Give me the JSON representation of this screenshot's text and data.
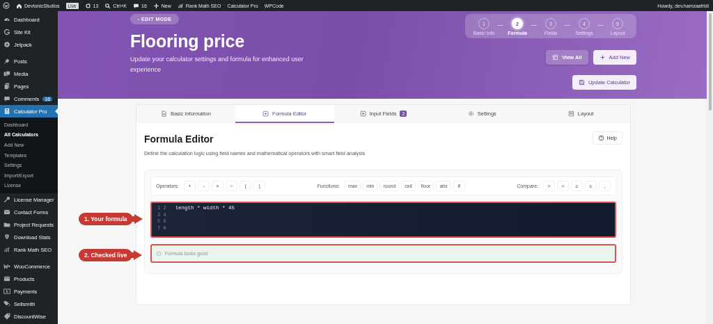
{
  "admin_bar": {
    "items": [
      {
        "kind": "link",
        "label": "DevtonicStudios"
      },
      {
        "kind": "badge",
        "label": "Live"
      },
      {
        "kind": "link",
        "label": "13"
      },
      {
        "kind": "link",
        "label": "Ctrl+K"
      },
      {
        "kind": "link",
        "label": "16"
      },
      {
        "kind": "link",
        "label": "New"
      },
      {
        "kind": "link",
        "label": "Rank Math SEO"
      },
      {
        "kind": "link",
        "label": "Calculator Pro"
      },
      {
        "kind": "link",
        "label": "WPCode"
      }
    ],
    "greeting": "Howdy, dev.hamzaafridi"
  },
  "sidebar": {
    "items": [
      {
        "label": "Dashboard",
        "selected": false
      },
      {
        "label": "Site Kit",
        "selected": false
      },
      {
        "label": "Jetpack",
        "selected": false
      },
      {
        "label": "Posts",
        "selected": false
      },
      {
        "label": "Media",
        "selected": false
      },
      {
        "label": "Pages",
        "selected": false
      },
      {
        "label": "Comments",
        "selected": false,
        "badge": "16"
      },
      {
        "label": "Calculator Pro",
        "selected": true,
        "children": [
          {
            "label": "Dashboard",
            "selected": false
          },
          {
            "label": "All Calculators",
            "selected": true
          },
          {
            "label": "Add New",
            "selected": false
          },
          {
            "label": "Templates",
            "selected": false
          },
          {
            "label": "Settings",
            "selected": false
          },
          {
            "label": "Import/Export",
            "selected": false
          },
          {
            "label": "License",
            "selected": false
          }
        ]
      },
      {
        "label": "License Manager",
        "selected": false
      },
      {
        "label": "Contact Forms",
        "selected": false
      },
      {
        "label": "Project Requests",
        "selected": false
      },
      {
        "label": "Download Stats",
        "selected": false
      },
      {
        "label": "Rank Math SEO",
        "selected": false
      },
      {
        "label": "WooCommerce",
        "selected": false
      },
      {
        "label": "Products",
        "selected": false
      },
      {
        "label": "Payments",
        "selected": false
      },
      {
        "label": "Sellsmith",
        "selected": false
      },
      {
        "label": "DiscountWise",
        "selected": false
      }
    ]
  },
  "hero": {
    "badge": "EDIT MODE",
    "title": "Flooring price",
    "subtitle": "Update your calculator settings and formula for enhanced user experience",
    "steps": [
      {
        "number": "1",
        "label": "Basic Info",
        "selected": false
      },
      {
        "number": "2",
        "label": "Formula",
        "selected": true
      },
      {
        "number": "3",
        "label": "Fields",
        "selected": false
      },
      {
        "number": "4",
        "label": "Settings",
        "selected": false
      },
      {
        "number": "5",
        "label": "Layout",
        "selected": false
      }
    ],
    "buttons": [
      "View All",
      "Add New"
    ],
    "update_button": "Update Calculator"
  },
  "tabs": [
    {
      "label": "Basic Information",
      "selected": false
    },
    {
      "label": "Formula Editor",
      "selected": true
    },
    {
      "label": "Input Fields",
      "selected": false,
      "badge": "2"
    },
    {
      "label": "Settings",
      "selected": false
    },
    {
      "label": "Layout",
      "selected": false
    }
  ],
  "editor": {
    "title": "Formula Editor",
    "description": "Define the calculation logic using field names and mathematical operators with smart field analysis",
    "help": "Help",
    "groups": [
      {
        "label": "Operators:",
        "buttons": [
          "+",
          "-",
          "×",
          "÷",
          "(",
          ")"
        ]
      },
      {
        "label": "Functions:",
        "buttons": [
          "max",
          "min",
          "round",
          "ceil",
          "floor",
          "abs",
          "if"
        ]
      },
      {
        "label": "Compare:",
        "buttons": [
          ">",
          "<",
          "≥",
          "≤",
          ","
        ]
      }
    ],
    "lines": [
      {
        "number": "1 2",
        "code": "length * width * 45"
      },
      {
        "number": "3 4"
      },
      {
        "number": "5 6"
      },
      {
        "number": "7 8"
      }
    ],
    "status": "Formula looks good",
    "callouts": [
      "1. Your formula",
      "2. Checked live"
    ]
  }
}
